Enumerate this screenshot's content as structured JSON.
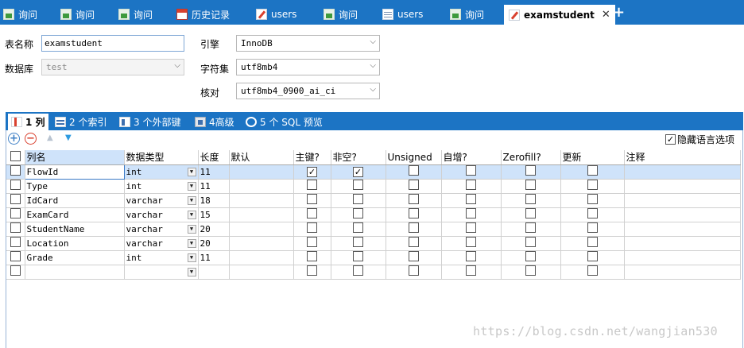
{
  "tabs": [
    {
      "label": "询问",
      "icon": "query-icon"
    },
    {
      "label": "询问",
      "icon": "query-icon"
    },
    {
      "label": "询问",
      "icon": "query-icon"
    },
    {
      "label": "历史记录",
      "icon": "calendar-icon"
    },
    {
      "label": "users",
      "icon": "table-design-icon"
    },
    {
      "label": "询问",
      "icon": "query-icon"
    },
    {
      "label": "users",
      "icon": "grid-icon"
    },
    {
      "label": "询问",
      "icon": "query-icon"
    },
    {
      "label": "examstudent",
      "icon": "table-design-icon",
      "active": true
    }
  ],
  "tab_close": "✕",
  "tab_add": "+",
  "form": {
    "table_name_label": "表名称",
    "table_name_value": "examstudent",
    "database_label": "数据库",
    "database_value": "test",
    "engine_label": "引擎",
    "engine_value": "InnoDB",
    "charset_label": "字符集",
    "charset_value": "utf8mb4",
    "collation_label": "核对",
    "collation_value": "utf8mb4_0900_ai_ci"
  },
  "subtabs": [
    {
      "label": "1 列",
      "icon": "columns-icon",
      "active": true
    },
    {
      "label": "2 个索引",
      "icon": "index-icon"
    },
    {
      "label": "3 个外部键",
      "icon": "foreign-key-icon"
    },
    {
      "label": "4高级",
      "icon": "advanced-icon"
    },
    {
      "label": "5 个 SQL 预览",
      "icon": "sql-preview-icon"
    }
  ],
  "toolbar": {
    "hide_language_label": "隐藏语言选项",
    "hide_language_checked": true
  },
  "columns_header": [
    "列名",
    "数据类型",
    "长度",
    "默认",
    "主键?",
    "非空?",
    "Unsigned",
    "自增?",
    "Zerofill?",
    "更新",
    "注释"
  ],
  "rows": [
    {
      "name": "FlowId",
      "type": "int",
      "length": "11",
      "default": "",
      "pk": true,
      "notnull": true,
      "selected": true
    },
    {
      "name": "Type",
      "type": "int",
      "length": "11",
      "default": "",
      "pk": false,
      "notnull": false
    },
    {
      "name": "IdCard",
      "type": "varchar",
      "length": "18",
      "default": "",
      "pk": false,
      "notnull": false
    },
    {
      "name": "ExamCard",
      "type": "varchar",
      "length": "15",
      "default": "",
      "pk": false,
      "notnull": false
    },
    {
      "name": "StudentName",
      "type": "varchar",
      "length": "20",
      "default": "",
      "pk": false,
      "notnull": false
    },
    {
      "name": "Location",
      "type": "varchar",
      "length": "20",
      "default": "",
      "pk": false,
      "notnull": false
    },
    {
      "name": "Grade",
      "type": "int",
      "length": "11",
      "default": "",
      "pk": false,
      "notnull": false
    },
    {
      "name": "",
      "type": "",
      "length": "",
      "default": "",
      "pk": false,
      "notnull": false
    }
  ],
  "watermark": "https://blog.csdn.net/wangjian530",
  "colors": {
    "accent": "#1c74c4",
    "selection": "#cfe3fa"
  }
}
